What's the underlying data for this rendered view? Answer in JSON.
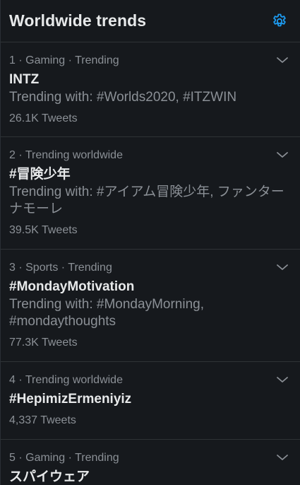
{
  "header": {
    "title": "Worldwide trends"
  },
  "trends": [
    {
      "meta": "1 · Gaming · Trending",
      "name": "INTZ",
      "with": "Trending with: #Worlds2020, #ITZWIN",
      "count": "26.1K Tweets"
    },
    {
      "meta": "2 · Trending worldwide",
      "name": "#冒険少年",
      "with": "Trending with: #アイアム冒険少年, ファンターナモーレ",
      "count": "39.5K Tweets"
    },
    {
      "meta": "3 · Sports · Trending",
      "name": "#MondayMotivation",
      "with": "Trending with: #MondayMorning, #mondaythoughts",
      "count": "77.3K Tweets"
    },
    {
      "meta": "4 · Trending worldwide",
      "name": "#HepimizErmeniyiz",
      "count": "4,337 Tweets"
    },
    {
      "meta": "5 · Gaming · Trending",
      "name": "スパイウェア"
    }
  ],
  "colors": {
    "accent": "#1d9bf0",
    "background": "#16191d",
    "primary_text": "#e7e9ea",
    "secondary_text": "#8b9096",
    "divider": "#2f3336"
  },
  "icons": {
    "settings": "gear-icon",
    "more": "chevron-down-icon"
  }
}
